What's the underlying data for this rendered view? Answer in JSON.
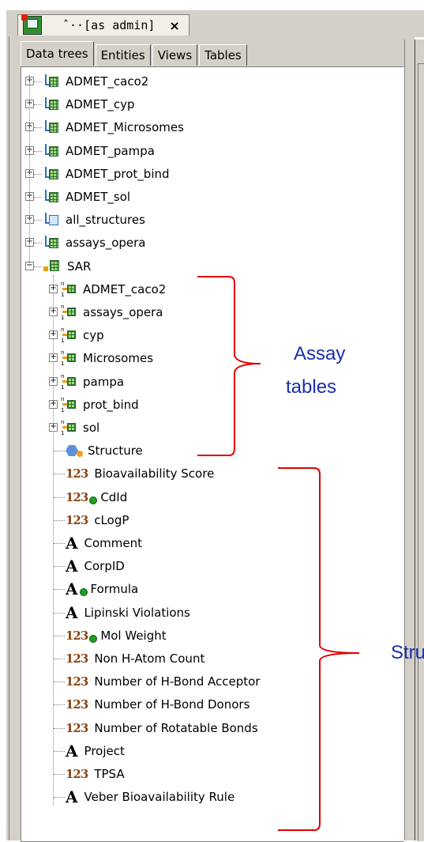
{
  "window": {
    "doc_tab_title": "ˆ··[as admin]",
    "doc_tab_close": "×"
  },
  "tabs": [
    {
      "label": "Data trees",
      "active": true
    },
    {
      "label": "Entities",
      "active": false
    },
    {
      "label": "Views",
      "active": false
    },
    {
      "label": "Tables",
      "active": false
    }
  ],
  "tree": {
    "top_level": [
      {
        "label": "ADMET_caco2",
        "icon": "table-icon"
      },
      {
        "label": "ADMET_cyp",
        "icon": "table-icon"
      },
      {
        "label": "ADMET_Microsomes",
        "icon": "table-icon"
      },
      {
        "label": "ADMET_pampa",
        "icon": "table-icon"
      },
      {
        "label": "ADMET_prot_bind",
        "icon": "table-icon"
      },
      {
        "label": "ADMET_sol",
        "icon": "table-icon"
      },
      {
        "label": "all_structures",
        "icon": "structure-table-icon"
      },
      {
        "label": "assays_opera",
        "icon": "table-icon"
      }
    ],
    "sar": {
      "label": "SAR",
      "subtables": [
        {
          "label": "ADMET_caco2"
        },
        {
          "label": "assays_opera"
        },
        {
          "label": "cyp"
        },
        {
          "label": "Microsomes"
        },
        {
          "label": "pampa"
        },
        {
          "label": "prot_bind"
        },
        {
          "label": "sol"
        }
      ],
      "fields": [
        {
          "label": "Structure",
          "icon": "structure-icon",
          "badge": "orange"
        },
        {
          "label": "Bioavailability Score",
          "icon": "number-icon"
        },
        {
          "label": "CdId",
          "icon": "number-icon",
          "badge": "green"
        },
        {
          "label": "cLogP",
          "icon": "number-icon"
        },
        {
          "label": "Comment",
          "icon": "text-icon"
        },
        {
          "label": "CorpID",
          "icon": "text-icon"
        },
        {
          "label": "Formula",
          "icon": "text-icon",
          "badge": "green"
        },
        {
          "label": "Lipinski Violations",
          "icon": "text-icon"
        },
        {
          "label": "Mol Weight",
          "icon": "number-icon",
          "badge": "green"
        },
        {
          "label": "Non H-Atom Count",
          "icon": "number-icon"
        },
        {
          "label": "Number of H-Bond Acceptor",
          "icon": "number-icon"
        },
        {
          "label": "Number of H-Bond Donors",
          "icon": "number-icon"
        },
        {
          "label": "Number of Rotatable Bonds",
          "icon": "number-icon"
        },
        {
          "label": "Project",
          "icon": "text-icon"
        },
        {
          "label": "TPSA",
          "icon": "number-icon"
        },
        {
          "label": "Veber Bioavailability Rule",
          "icon": "text-icon"
        }
      ]
    },
    "number_glyph": "123",
    "text_glyph": "A"
  },
  "annotations": {
    "assay_line1": "Assay",
    "assay_line2": "tables",
    "structure_label": "Stru"
  },
  "colors": {
    "annotation_text": "#1a2faa",
    "bracket": "#e00000"
  }
}
